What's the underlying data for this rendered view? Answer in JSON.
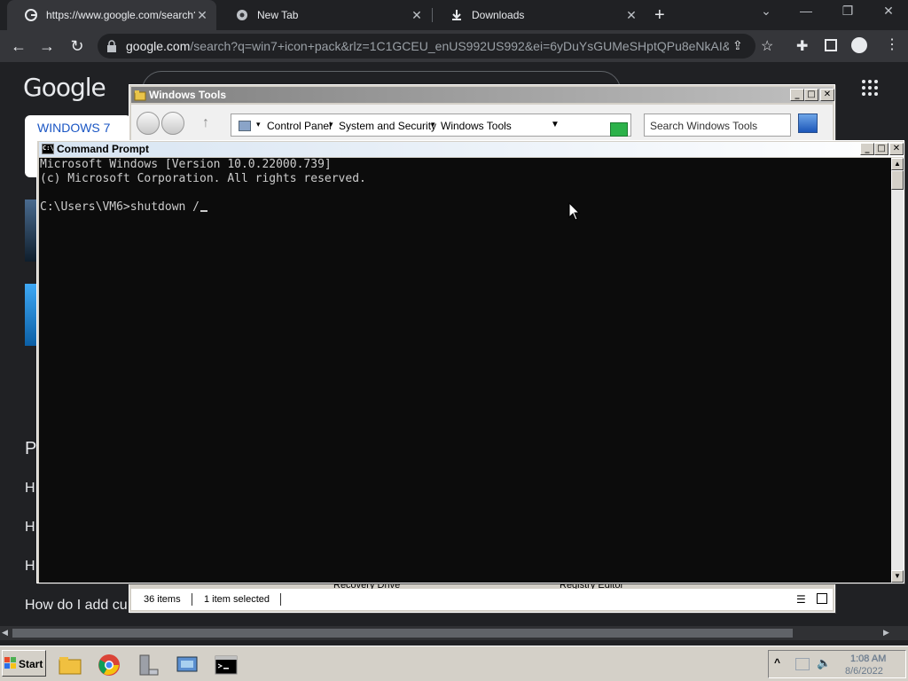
{
  "browser": {
    "tabs": [
      {
        "title": "https://www.google.com/search?q=",
        "close": "✕"
      },
      {
        "title": "New Tab",
        "close": "✕"
      },
      {
        "title": "Downloads",
        "close": "✕"
      }
    ],
    "new_tab": "+",
    "url_host": "google.com",
    "url_rest": "/search?q=win7+icon+pack&rlz=1C1GCEU_enUS992US992&ei=6yDuYsGUMeSHptQPu8eNkAI&...",
    "logo": "Google",
    "thumb_label": "WINDOWS 7",
    "result_lines": [
      "P",
      "H",
      "H",
      "H",
      "How do I add cu"
    ]
  },
  "windows_tools": {
    "title": "Windows Tools",
    "breadcrumbs": [
      "Control Panel",
      "System and Security",
      "Windows Tools"
    ],
    "search_placeholder": "Search Windows Tools",
    "status_items": "36 items",
    "status_selected": "1 item selected",
    "peek_left": "Recovery Drive",
    "peek_right": "Registry Editor"
  },
  "cmd": {
    "title": "Command Prompt",
    "icon_text": "C:\\",
    "lines": [
      "Microsoft Windows [Version 10.0.22000.739]",
      "(c) Microsoft Corporation. All rights reserved.",
      "",
      "C:\\Users\\VM6>shutdown /"
    ]
  },
  "taskbar": {
    "start_label": "Start",
    "time": "1:08 AM",
    "date": "8/6/2022",
    "tray_expand": "^"
  }
}
